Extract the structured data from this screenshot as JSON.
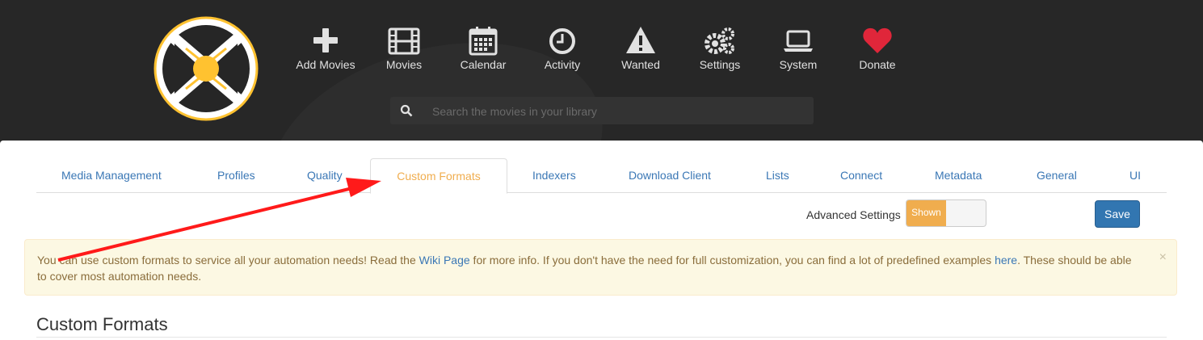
{
  "nav": {
    "items": [
      {
        "label": "Add Movies",
        "icon": "plus-icon"
      },
      {
        "label": "Movies",
        "icon": "film-icon"
      },
      {
        "label": "Calendar",
        "icon": "calendar-icon"
      },
      {
        "label": "Activity",
        "icon": "clock-icon"
      },
      {
        "label": "Wanted",
        "icon": "warning-icon"
      },
      {
        "label": "Settings",
        "icon": "gears-icon"
      },
      {
        "label": "System",
        "icon": "laptop-icon"
      },
      {
        "label": "Donate",
        "icon": "heart-icon"
      }
    ]
  },
  "search": {
    "placeholder": "Search the movies in your library",
    "icon": "search-icon"
  },
  "tabs": [
    {
      "label": "Media Management",
      "active": false
    },
    {
      "label": "Profiles",
      "active": false
    },
    {
      "label": "Quality",
      "active": false
    },
    {
      "label": "Custom Formats",
      "active": true
    },
    {
      "label": "Indexers",
      "active": false
    },
    {
      "label": "Download Client",
      "active": false
    },
    {
      "label": "Lists",
      "active": false
    },
    {
      "label": "Connect",
      "active": false
    },
    {
      "label": "Metadata",
      "active": false
    },
    {
      "label": "General",
      "active": false
    },
    {
      "label": "UI",
      "active": false
    }
  ],
  "toolbar": {
    "advanced_label": "Advanced Settings",
    "advanced_state": "Shown",
    "save_label": "Save"
  },
  "alert": {
    "part1": "You can use custom formats to service all your automation needs! Read the ",
    "link1": "Wiki Page",
    "part2": " for more info. If you don't have the need for full customization, you can find a lot of predefined examples ",
    "link2": "here",
    "part3": ". These should be able to cover most automation needs.",
    "close": "×"
  },
  "section": {
    "title": "Custom Formats"
  },
  "colors": {
    "header_bg": "#272727",
    "accent": "#f0ad4e",
    "link": "#3a77b5",
    "primary": "#3276b1",
    "annotation_arrow": "#ff1a1a"
  }
}
